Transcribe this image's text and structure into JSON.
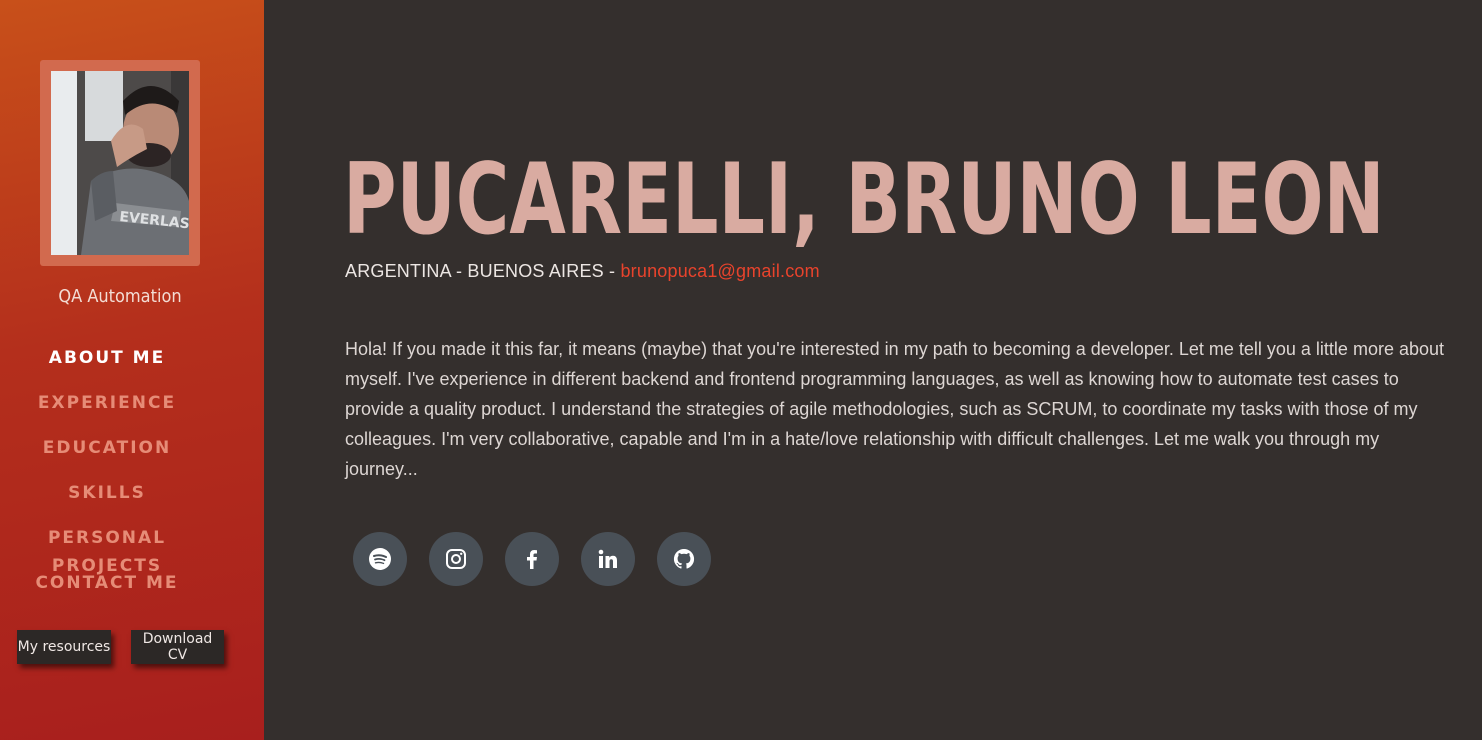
{
  "sidebar": {
    "role": "QA Automation",
    "nav": [
      {
        "label": "ABOUT ME",
        "active": true
      },
      {
        "label": "EXPERIENCE",
        "active": false
      },
      {
        "label": "EDUCATION",
        "active": false
      },
      {
        "label": "SKILLS",
        "active": false
      },
      {
        "label": "PERSONAL PROJECTS",
        "active": false
      },
      {
        "label": "CONTACT ME",
        "active": false
      }
    ],
    "resources_label": "My resources",
    "cv_label": "Download CV"
  },
  "main": {
    "name": "PUCARELLI, BRUNO LEON",
    "location": "ARGENTINA - BUENOS AIRES - ",
    "email": "brunopuca1@gmail.com",
    "bio": "Hola! If you made it this far, it means (maybe) that you're interested in my path to becoming a developer. Let me tell you a little more about myself. I've experience in different backend and frontend programming languages, as well as knowing how to automate test cases to provide a quality product. I understand the strategies of agile methodologies, such as SCRUM, to coordinate my tasks with those of my colleagues. I'm very collaborative, capable and I'm in a hate/love relationship with difficult challenges. Let me walk you through my journey..."
  },
  "socials": [
    "spotify-icon",
    "instagram-icon",
    "facebook-icon",
    "linkedin-icon",
    "github-icon"
  ],
  "colors": {
    "sidebar_top": "#c8501a",
    "sidebar_bottom": "#a81f1d",
    "background": "#342f2d",
    "name": "#d9aba1",
    "email": "#e8432c",
    "social_bg": "#495057"
  }
}
